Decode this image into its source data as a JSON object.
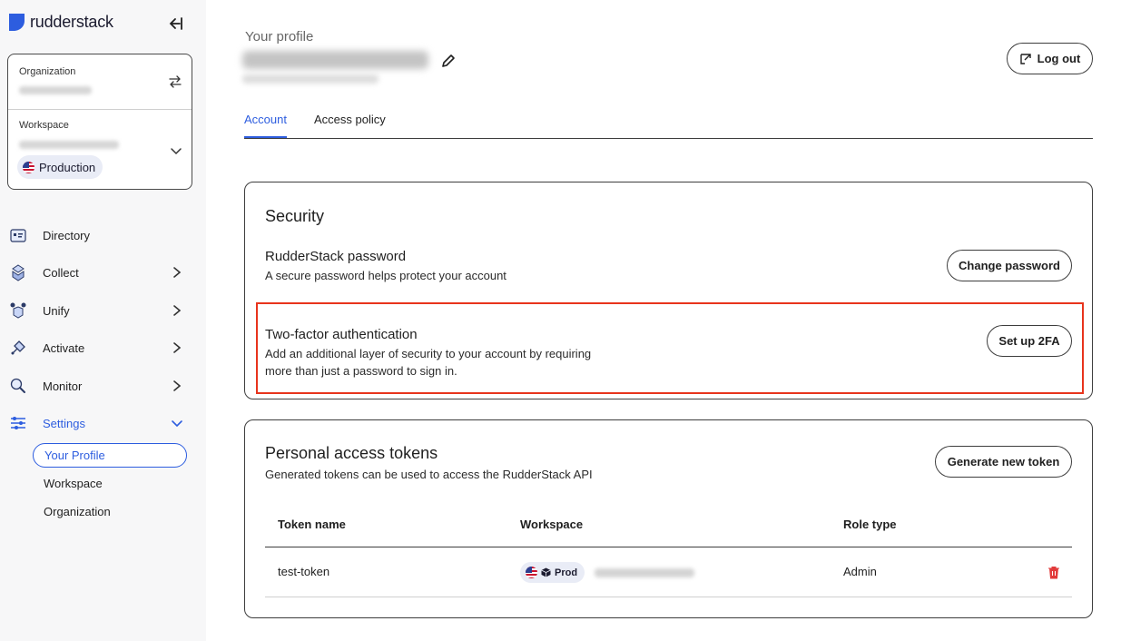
{
  "brand": {
    "name": "rudderstack",
    "accent": "#2d5ddf"
  },
  "sidebar": {
    "organization_label": "Organization",
    "workspace_label": "Workspace",
    "environment": "Production",
    "nav": [
      {
        "label": "Directory",
        "icon": "directory-icon"
      },
      {
        "label": "Collect",
        "icon": "collect-icon"
      },
      {
        "label": "Unify",
        "icon": "unify-icon"
      },
      {
        "label": "Activate",
        "icon": "activate-icon"
      },
      {
        "label": "Monitor",
        "icon": "monitor-icon"
      },
      {
        "label": "Settings",
        "icon": "settings-icon"
      }
    ],
    "settings_sub": [
      "Your Profile",
      "Workspace",
      "Organization"
    ]
  },
  "header": {
    "title": "Your profile",
    "logout_label": "Log out"
  },
  "tabs": [
    "Account",
    "Access policy"
  ],
  "security": {
    "title": "Security",
    "password_title": "RudderStack password",
    "password_desc": "A secure password helps protect your account",
    "change_password_label": "Change password",
    "twofa_title": "Two-factor authentication",
    "twofa_desc_1": "Add an additional layer of security to your account by requiring",
    "twofa_desc_2": "more than just a password to sign in.",
    "twofa_button": "Set up 2FA"
  },
  "tokens": {
    "title": "Personal access tokens",
    "desc": "Generated tokens can be used to access the RudderStack API",
    "generate_label": "Generate new token",
    "columns": [
      "Token name",
      "Workspace",
      "Role type"
    ],
    "rows": [
      {
        "name": "test-token",
        "env": "Prod",
        "role": "Admin"
      }
    ]
  }
}
